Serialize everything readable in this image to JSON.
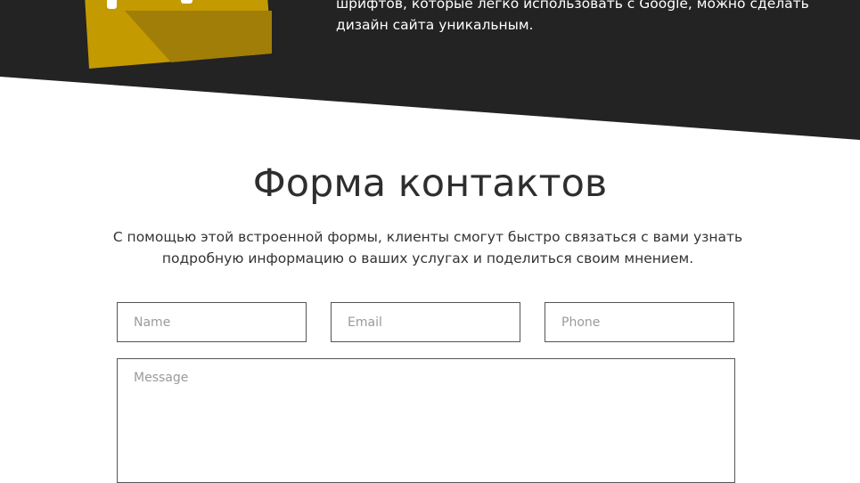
{
  "hero": {
    "text_line1": "шрифтов, которые легко  использовать с Google, можно сделать",
    "text_line2": "дизайн сайта уникальным.",
    "colors": {
      "background": "#232323",
      "icon_tile": "#c39a00",
      "icon_tile_shadow": "#a17e08"
    }
  },
  "contact": {
    "title": "Форма контактов",
    "description_line1": "С помощью этой встроенной формы, клиенты смогут быстро связаться с вами узнать",
    "description_line2": "подробную информацию о ваших услугах и поделиться своим мнением.",
    "form": {
      "name_placeholder": "Name",
      "email_placeholder": "Email",
      "phone_placeholder": "Phone",
      "message_placeholder": "Message"
    }
  }
}
